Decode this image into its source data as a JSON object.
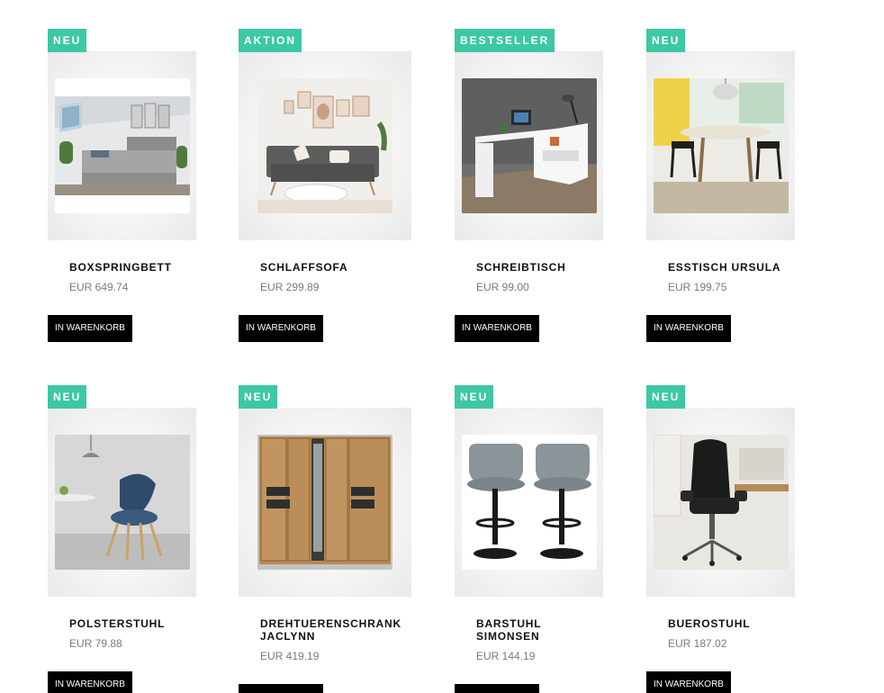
{
  "products": [
    {
      "badge": "NEU",
      "title": "BOXSPRINGBETT",
      "price": "EUR 649.74",
      "cart": "IN WARENKORB"
    },
    {
      "badge": "AKTION",
      "title": "SCHLAFFSOFA",
      "price": "EUR 299.89",
      "cart": "IN WARENKORB"
    },
    {
      "badge": "BESTSELLER",
      "title": "SCHREIBTISCH",
      "price": "EUR 99.00",
      "cart": "IN WARENKORB"
    },
    {
      "badge": "NEU",
      "title": "ESSTISCH URSULA",
      "price": "EUR 199.75",
      "cart": "IN WARENKORB"
    },
    {
      "badge": "NEU",
      "title": "POLSTERSTUHL",
      "price": "EUR 79.88",
      "cart": "IN WARENKORB"
    },
    {
      "badge": "NEU",
      "title": "DREHTUERENSCHRANK\nJACLYNN",
      "price": "EUR 419.19",
      "cart": ""
    },
    {
      "badge": "NEU",
      "title": "BARSTUHL\nSIMONSEN",
      "price": "EUR 144.19",
      "cart": ""
    },
    {
      "badge": "NEU",
      "title": "BUEROSTUHL",
      "price": "EUR 187.02",
      "cart": "IN WARENKORB"
    }
  ],
  "colors": {
    "badge": "#3cc8a4",
    "button": "#000000",
    "price": "#7a7a7a"
  }
}
